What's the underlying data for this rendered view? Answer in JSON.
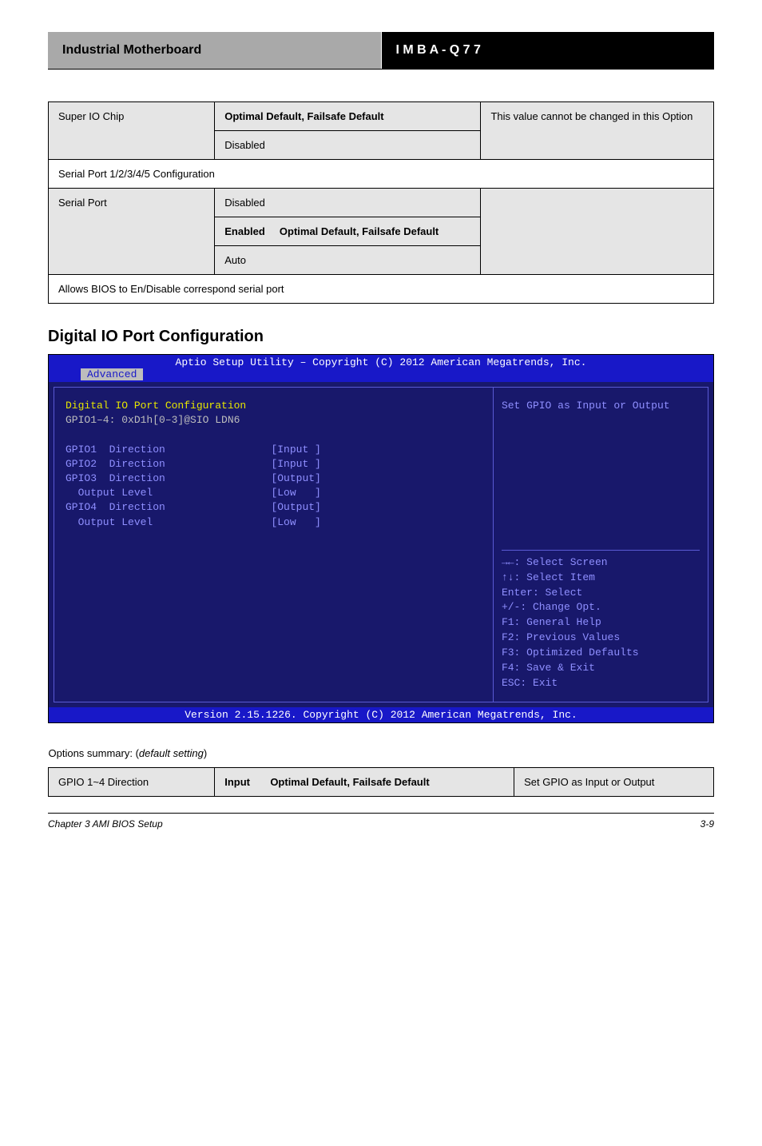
{
  "header": {
    "left": "Industrial Motherboard",
    "right_prefix": "I M B A",
    "right_suffix": "- Q 7 7"
  },
  "table1": {
    "r1c1": "Super IO Chip",
    "r1c2": "Optimal Default, Failsafe Default",
    "r1c3": "This value cannot be changed in this Option",
    "r2c2": "Disabled",
    "r3span": "Serial Port 1/2/3/4/5 Configuration",
    "r4c1": "Serial Port",
    "r4c2": "Disabled",
    "r4c3": "",
    "r5c2": "Enabled",
    "r5c2b": "Optimal Default, Failsafe Default",
    "r6c2": "Auto",
    "r7span": "Allows BIOS to En/Disable correspond serial port"
  },
  "section_title": "Digital IO Port Configuration",
  "bios": {
    "top": "Aptio Setup Utility – Copyright (C) 2012 American Megatrends, Inc.",
    "tab": "Advanced",
    "left_title": "Digital IO Port Configuration",
    "left_sub": "GPIO1–4: 0xD1h[0–3]@SIO LDN6",
    "rows": [
      {
        "label": "GPIO1  Direction",
        "value": "[Input ]"
      },
      {
        "label": "GPIO2  Direction",
        "value": "[Input ]"
      },
      {
        "label": "GPIO3  Direction",
        "value": "[Output]"
      },
      {
        "label": "  Output Level",
        "value": "[Low   ]"
      },
      {
        "label": "GPIO4  Direction",
        "value": "[Output]"
      },
      {
        "label": "  Output Level",
        "value": "[Low   ]"
      }
    ],
    "right_desc": "Set GPIO as Input or Output",
    "help": "→←: Select Screen\n↑↓: Select Item\nEnter: Select\n+/-: Change Opt.\nF1: General Help\nF2: Previous Values\nF3: Optimized Defaults\nF4: Save & Exit\nESC: Exit",
    "bottom": "Version 2.15.1226. Copyright (C) 2012 American Megatrends, Inc."
  },
  "table2": {
    "h1": "Options summary: (",
    "h1i": "default setting",
    "h1e": ")",
    "c1": "GPIO 1~4 Direction",
    "c2": "Input",
    "c2b": "Optimal Default, Failsafe Default",
    "c3": "Set GPIO as Input or Output"
  },
  "footer": {
    "left": "Chapter 3 AMI BIOS Setup",
    "right": "3-9"
  }
}
